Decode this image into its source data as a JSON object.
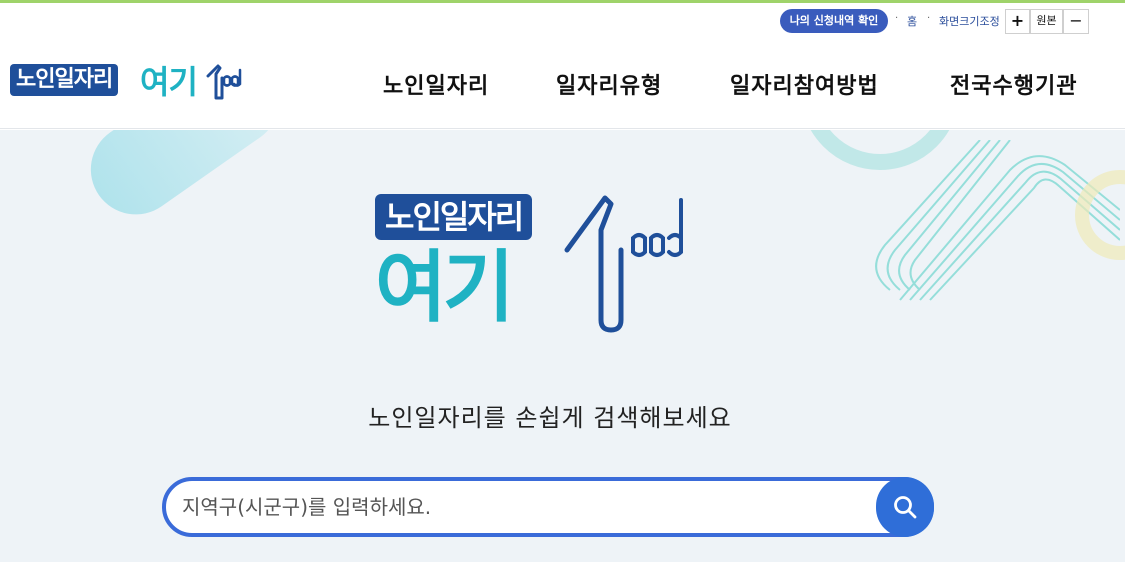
{
  "utility": {
    "apply_history_label": "나의 신청내역 확인",
    "separator": "·",
    "home_label": "홈",
    "zoom_label": "화면크기조정",
    "zoom_in_label": "+",
    "zoom_reset_label": "원본",
    "zoom_out_label": "−"
  },
  "header": {
    "logo_part1": "노인일자리",
    "logo_part2": "여기",
    "nav": [
      {
        "label": "노인일자리"
      },
      {
        "label": "일자리유형"
      },
      {
        "label": "일자리참여방법"
      },
      {
        "label": "전국수행기관"
      }
    ]
  },
  "hero": {
    "logo_part1": "노인일자리",
    "logo_part2": "여기",
    "tagline": "노인일자리를 손쉽게 검색해보세요",
    "search": {
      "placeholder": "지역구(시군구)를 입력하세요.",
      "value": "",
      "button_icon": "search-icon"
    }
  },
  "colors": {
    "brand_navy": "#1f4f9a",
    "brand_teal": "#1fb2c3",
    "accent_blue": "#2f6ed8",
    "hero_bg": "#eef3f7"
  }
}
